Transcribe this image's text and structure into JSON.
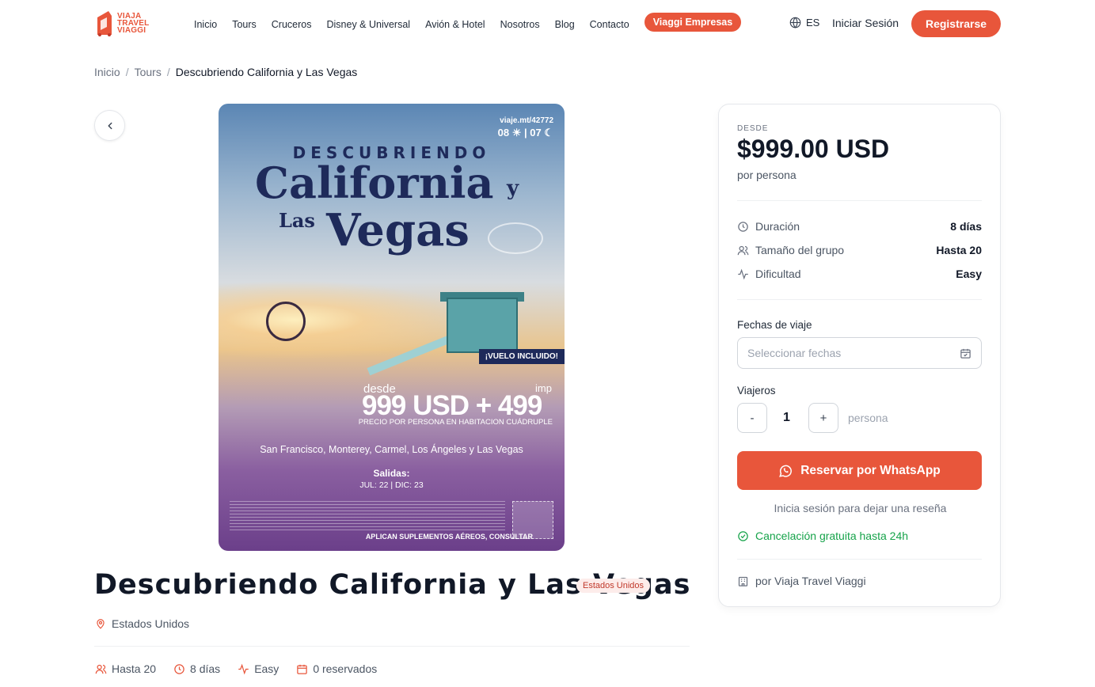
{
  "header": {
    "logo_lines": [
      "VIAJA",
      "TRAVEL",
      "VIAGGI"
    ],
    "nav": [
      "Inicio",
      "Tours",
      "Cruceros",
      "Disney & Universal",
      "Avión & Hotel",
      "Nosotros",
      "Blog",
      "Contacto"
    ],
    "empresas": "Viaggi Empresas",
    "lang": "ES",
    "login": "Iniciar Sesión",
    "register": "Registrarse"
  },
  "breadcrumb": [
    "Inicio",
    "Tours",
    "Descubriendo California y Las Vegas"
  ],
  "poster": {
    "code": "viaje.mt/42772",
    "days": "08",
    "nights": "07",
    "descubriendo": "DESCUBRIENDO",
    "california": "California",
    "y": "y",
    "las": "Las",
    "vegas": "Vegas",
    "vuelo": "¡VUELO INCLUIDO!",
    "desde": "desde",
    "imp": "imp",
    "price": "999 USD + 499",
    "per_person": "PRECIO POR PERSONA EN HABITACION CUÁDRUPLE",
    "cities": "San Francisco, Monterey, Carmel, Los Ángeles y Las Vegas",
    "salidas": "Salidas:",
    "dates": "JUL: 22 | DIC: 23",
    "suplementos": "APLICAN SUPLEMENTOS AÉREOS, CONSULTAR"
  },
  "tour": {
    "title": "Descubriendo California y Las Vegas",
    "country": "Estados Unidos",
    "location": "Estados Unidos",
    "stats": {
      "group": "Hasta 20",
      "duration": "8 días",
      "difficulty": "Easy",
      "booked": "0 reservados"
    }
  },
  "booking": {
    "desde": "DESDE",
    "price": "$999.00 USD",
    "per": "por persona",
    "duration_label": "Duración",
    "duration_value": "8 días",
    "group_label": "Tamaño del grupo",
    "group_value": "Hasta 20",
    "difficulty_label": "Dificultad",
    "difficulty_value": "Easy",
    "dates_label": "Fechas de viaje",
    "dates_placeholder": "Seleccionar fechas",
    "travelers_label": "Viajeros",
    "minus": "-",
    "count": "1",
    "plus": "+",
    "persona": "persona",
    "whatsapp": "Reservar por WhatsApp",
    "review": "Inicia sesión para dejar una reseña",
    "cancel": "Cancelación gratuita hasta 24h",
    "provider": "por Viaja Travel Viaggi"
  },
  "colors": {
    "accent": "#e8563b",
    "success": "#16a34a",
    "navy": "#1e2a5a"
  }
}
